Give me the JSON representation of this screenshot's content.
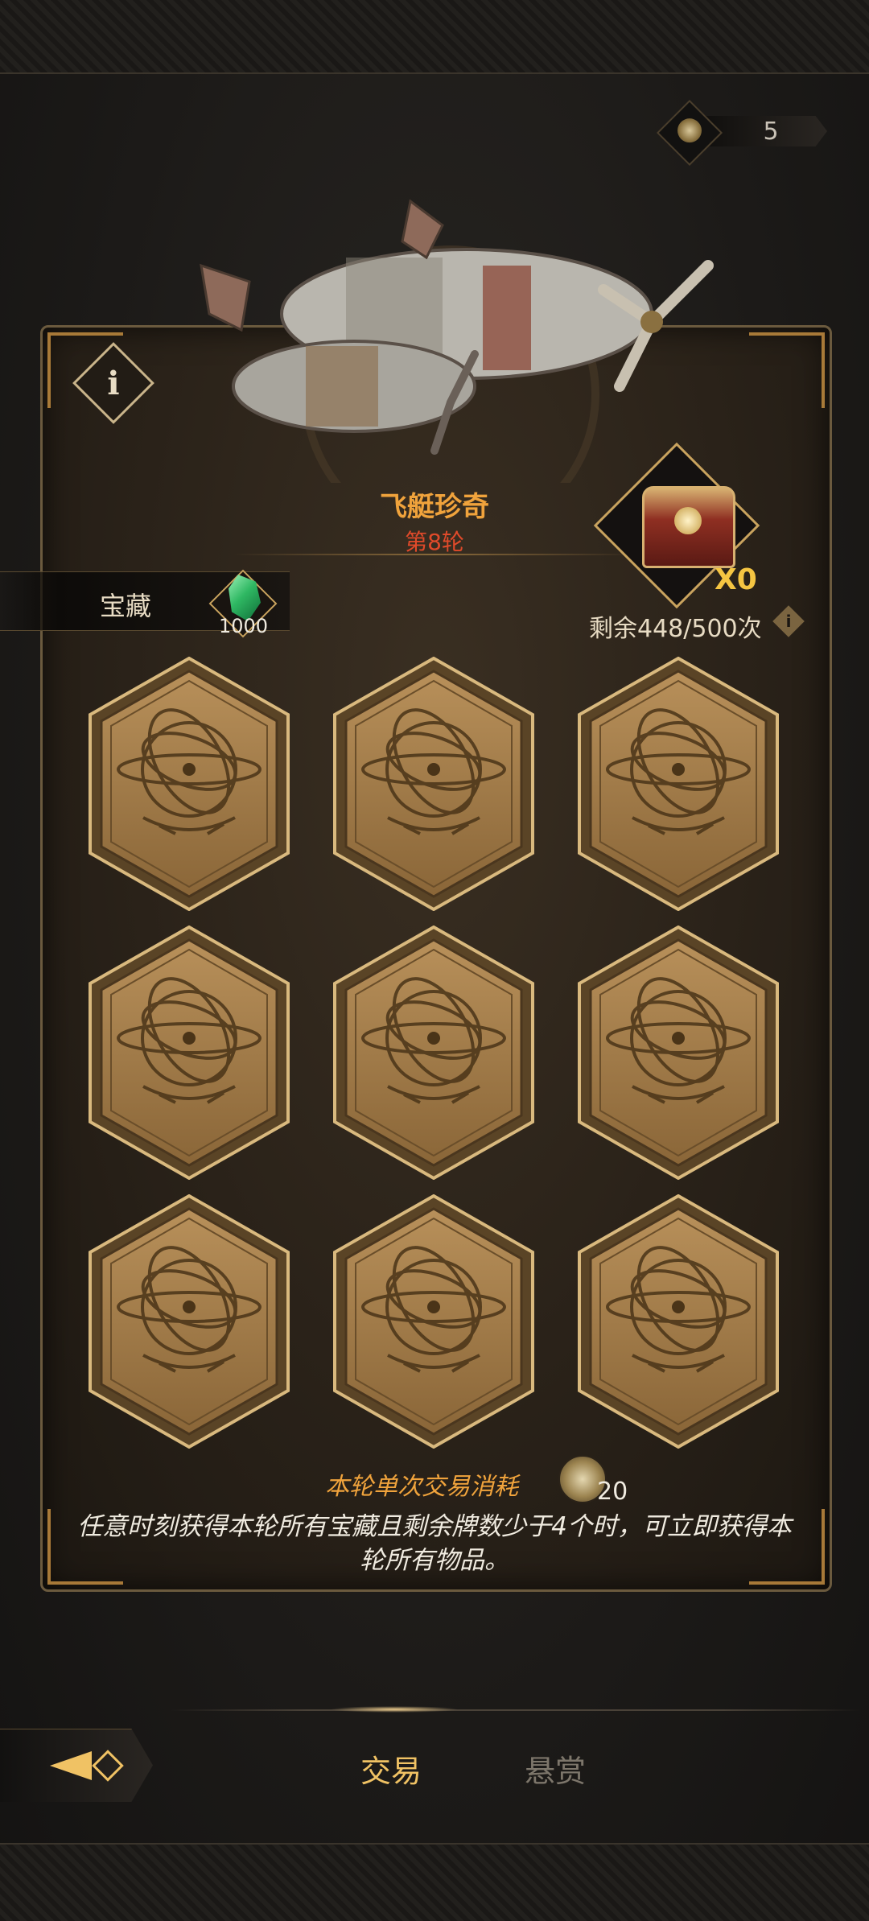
{
  "currency": {
    "value": "5",
    "icon": "gear-coin-icon"
  },
  "event": {
    "title": "飞艇珍奇",
    "round": "第8轮"
  },
  "treasure": {
    "label": "宝藏",
    "gem_count": "1000"
  },
  "chest": {
    "count": "X0",
    "remaining": "剩余448/500次"
  },
  "cards": [
    {
      "state": "face-down"
    },
    {
      "state": "face-down"
    },
    {
      "state": "face-down"
    },
    {
      "state": "face-down"
    },
    {
      "state": "face-down"
    },
    {
      "state": "face-down"
    },
    {
      "state": "face-down"
    },
    {
      "state": "face-down"
    },
    {
      "state": "face-down"
    }
  ],
  "cost": {
    "label": "本轮单次交易消耗",
    "value": "20"
  },
  "description": "任意时刻获得本轮所有宝藏且剩余牌数少于4个时，可立即获得本轮所有物品。",
  "nav": {
    "tab_trade": "交易",
    "tab_bounty": "悬赏"
  },
  "colors": {
    "accent": "#f0a33c",
    "round": "#e04a2a",
    "gold": "#f5c542"
  }
}
